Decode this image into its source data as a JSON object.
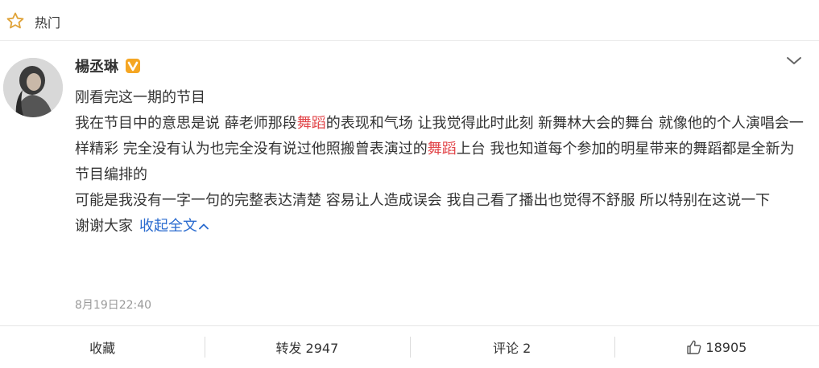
{
  "header": {
    "label": "热门",
    "icon": "star-outline-icon"
  },
  "post": {
    "author": "楊丞琳",
    "verified_badge": "V",
    "badge_color": "#f5a623",
    "line1": "刚看完这一期的节目",
    "para2": {
      "a": "我在节目中的意思是说 薛老师那段",
      "h1": "舞蹈",
      "b": "的表现和气场 让我觉得此时此刻 新舞林大会的舞台 就像他的个人演唱会一样精彩 完全没有认为也完全没有说过他照搬曾表演过的",
      "h2": "舞蹈",
      "c": "上台 我也知道每个参加的明星带来的舞蹈都是全新为节目编排的"
    },
    "para3": "可能是我没有一字一句的完整表达清楚 容易让人造成误会 我自己看了播出也觉得不舒服 所以特别在这说一下",
    "para4": "谢谢大家",
    "collapse_label": "收起全文",
    "highlight_color": "#e2464a",
    "link_color": "#2a6bcf",
    "timestamp": "8月19日22:40"
  },
  "footer": {
    "favorite": "收藏",
    "repost": "转发 2947",
    "comment": "评论 2",
    "like_count": "18905"
  }
}
